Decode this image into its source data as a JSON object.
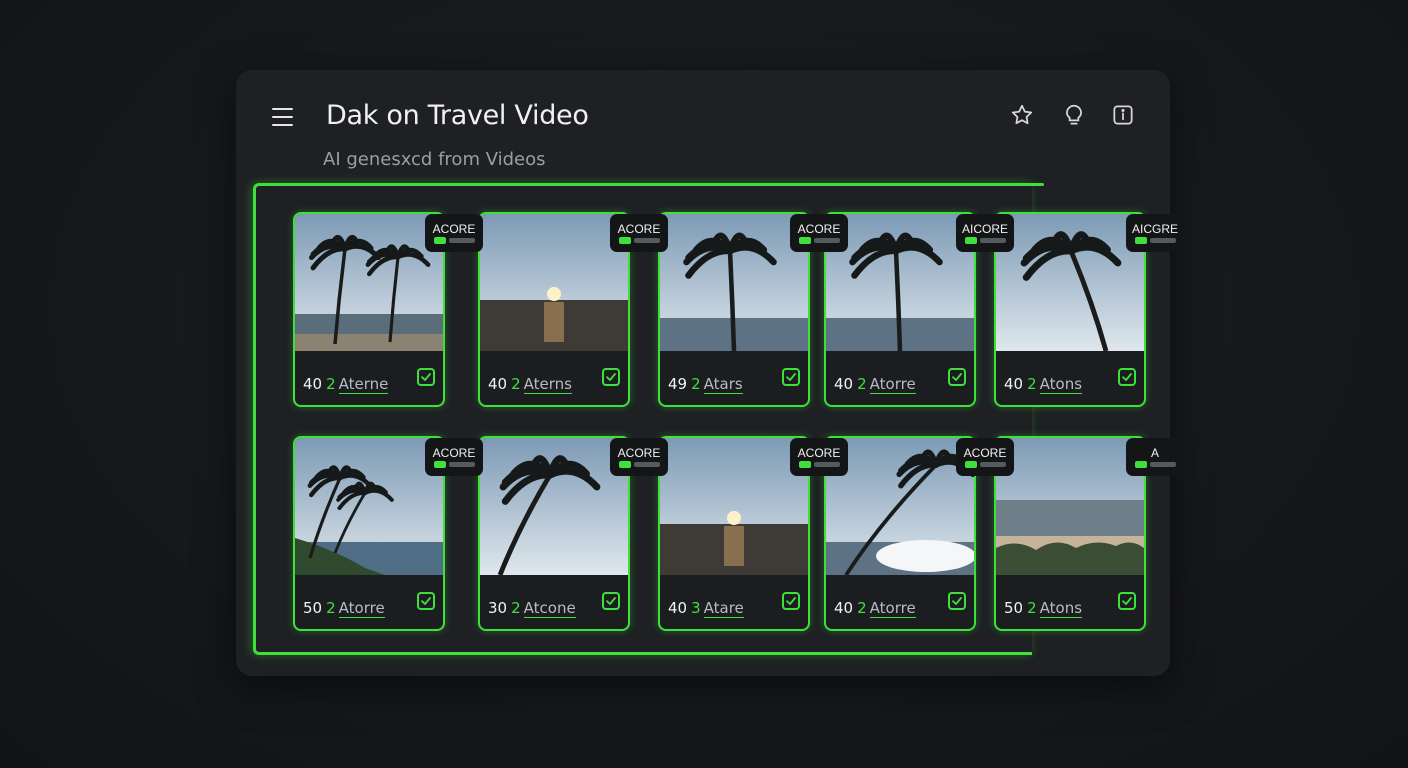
{
  "header": {
    "title": "Dak on Travel Video",
    "subtitle": "AI genesxcd from Videos"
  },
  "toolbar": {
    "icons": [
      "star-icon",
      "lightbulb-icon",
      "info-icon"
    ]
  },
  "accent_color": "#3fe03a",
  "cards": [
    {
      "badge": "ACORE",
      "number": "40",
      "num2": "2",
      "label": "Aterne",
      "scene": "palms-beach"
    },
    {
      "badge": "ACORE",
      "number": "40",
      "num2": "2",
      "label": "Aterns",
      "scene": "sunset-sea"
    },
    {
      "badge": "ACORE",
      "number": "49",
      "num2": "2",
      "label": "Atars",
      "scene": "palm-sky"
    },
    {
      "badge": "AICORE",
      "number": "40",
      "num2": "2",
      "label": "Atorre",
      "scene": "palm-sky-light"
    },
    {
      "badge": "AICGRE",
      "number": "40",
      "num2": "2",
      "label": "Atons",
      "scene": "palm-dusk"
    },
    {
      "badge": "ACORE",
      "number": "50",
      "num2": "2",
      "label": "Atorre",
      "scene": "palms-coast"
    },
    {
      "badge": "ACORE",
      "number": "30",
      "num2": "2",
      "label": "Atcone",
      "scene": "palm-sunset"
    },
    {
      "badge": "ACORE",
      "number": "40",
      "num2": "3",
      "label": "Atare",
      "scene": "sunset-sea"
    },
    {
      "badge": "ACORE",
      "number": "40",
      "num2": "2",
      "label": "Atorre",
      "scene": "palm-clouds"
    },
    {
      "badge": "A",
      "number": "50",
      "num2": "2",
      "label": "Atons",
      "scene": "beach-shrubs"
    }
  ]
}
